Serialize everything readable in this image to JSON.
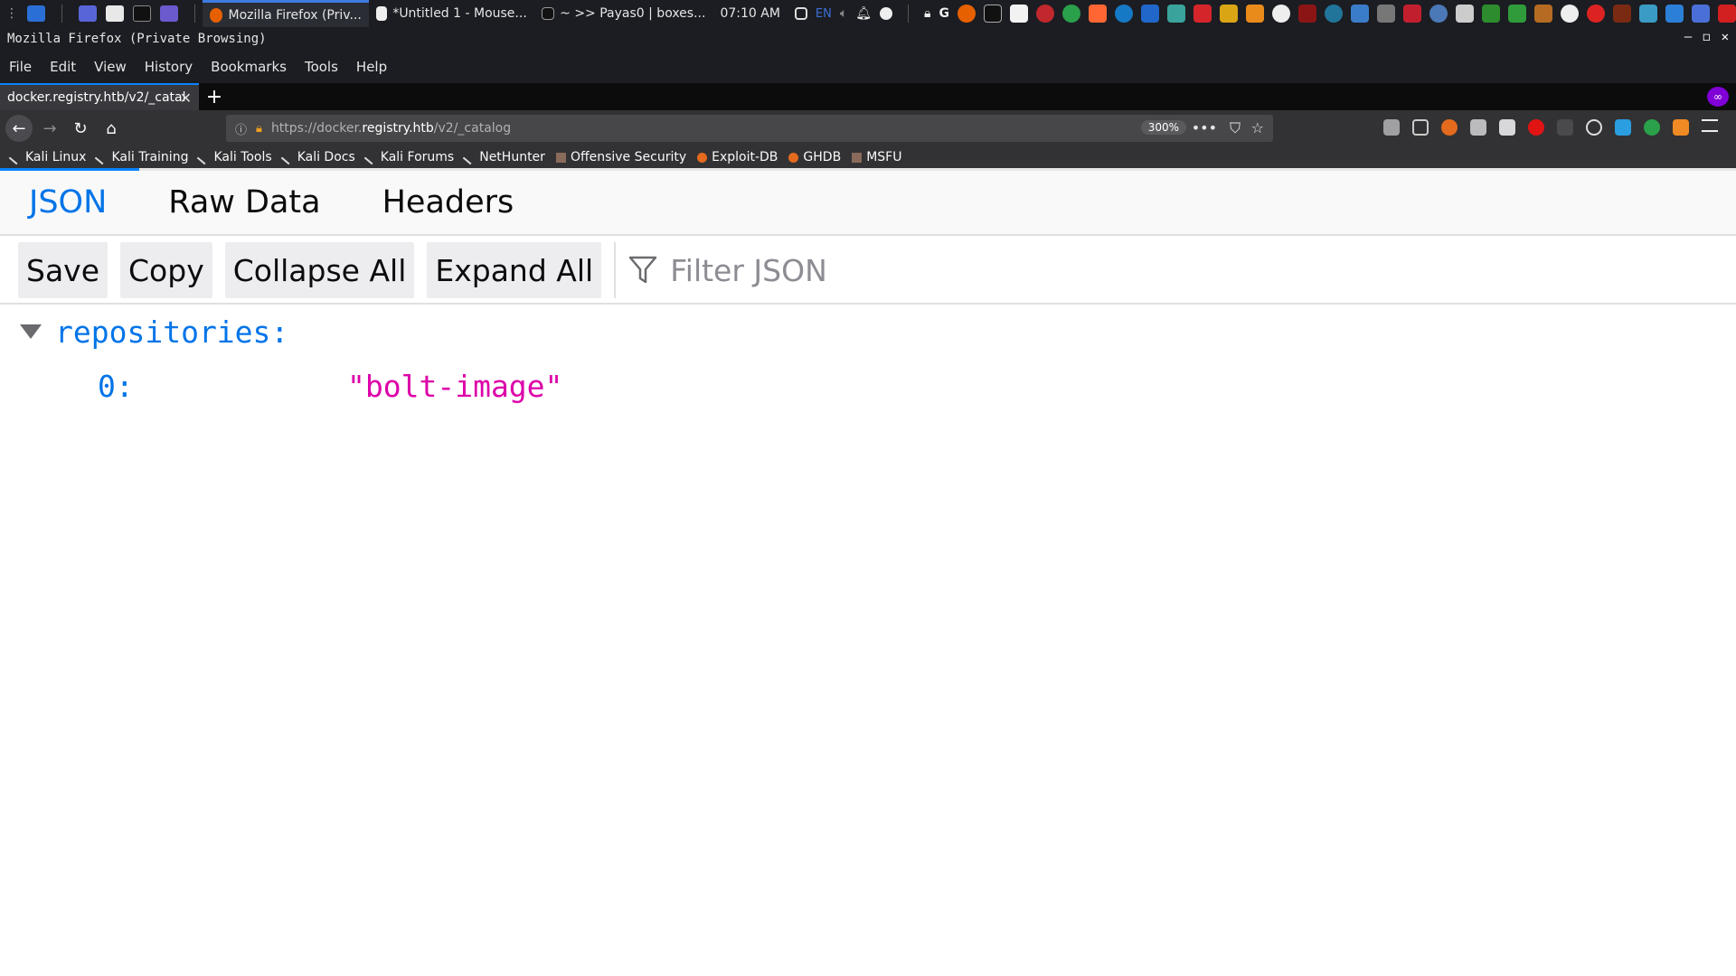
{
  "taskbar": {
    "tasks": [
      {
        "label": "Mozilla Firefox (Priv...",
        "active": true
      },
      {
        "label": "*Untitled 1 - Mouse...",
        "active": false
      },
      {
        "label": "~ >> Payas0 | boxes...",
        "active": false
      }
    ],
    "clock": "07:10 AM",
    "keyboard_layout": "EN",
    "colors": {
      "bg": "#1b1d22",
      "active_indicator": "#3d7be0"
    }
  },
  "window": {
    "title": "Mozilla Firefox (Private Browsing)",
    "controls": [
      "minimize-icon",
      "maximize-icon",
      "close-icon"
    ]
  },
  "menubar": {
    "items": [
      {
        "label": "File"
      },
      {
        "label": "Edit"
      },
      {
        "label": "View"
      },
      {
        "label": "History"
      },
      {
        "label": "Bookmarks"
      },
      {
        "label": "Tools"
      },
      {
        "label": "Help"
      }
    ]
  },
  "tabs": [
    {
      "title": "docker.registry.htb/v2/_catal",
      "active": true
    }
  ],
  "navbar": {
    "url_prefix": "https://docker.",
    "url_host": "registry.htb",
    "url_path": "/v2/_catalog",
    "zoom": "300%",
    "icons": [
      "back-arrow-icon",
      "forward-arrow-icon",
      "reload-icon",
      "home-icon",
      "info-icon",
      "lock-icon",
      "page-actions-icon",
      "pocket-icon",
      "bookmark-star-icon"
    ]
  },
  "bookmarks": [
    {
      "label": "Kali Linux"
    },
    {
      "label": "Kali Training"
    },
    {
      "label": "Kali Tools"
    },
    {
      "label": "Kali Docs"
    },
    {
      "label": "Kali Forums"
    },
    {
      "label": "NetHunter"
    },
    {
      "label": "Offensive Security"
    },
    {
      "label": "Exploit-DB"
    },
    {
      "label": "GHDB"
    },
    {
      "label": "MSFU"
    }
  ],
  "page_load_progress": 0.08,
  "json_viewer": {
    "tabs": [
      {
        "label": "JSON",
        "selected": true
      },
      {
        "label": "Raw Data",
        "selected": false
      },
      {
        "label": "Headers",
        "selected": false
      }
    ],
    "toolbar": {
      "save": "Save",
      "copy": "Copy",
      "collapse_all": "Collapse All",
      "expand_all": "Expand All",
      "filter_placeholder": "Filter JSON"
    },
    "tree": {
      "root_key": "repositories:",
      "items": [
        {
          "key": "0:",
          "value": "\"bolt-image\""
        }
      ]
    },
    "colors": {
      "key": "#0074e8",
      "string": "#dd00a9",
      "selected_tab": "#0074e8"
    }
  }
}
